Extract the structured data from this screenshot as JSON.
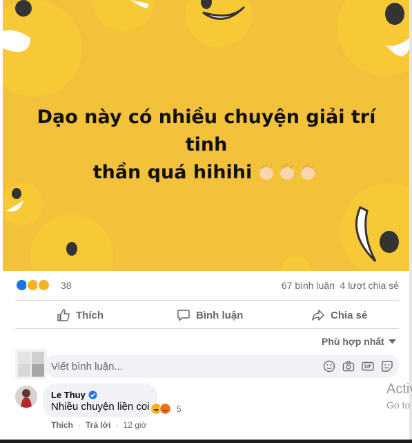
{
  "post": {
    "text_line1": "Dạo này có nhiều chuyện giải trí tinh",
    "text_line2": "thần quá hihihi",
    "background_color": "#f4c13a",
    "emoji_icons": [
      "clapping-hands-icon",
      "clapping-hands-icon",
      "clapping-hands-icon"
    ]
  },
  "stats": {
    "reaction_icons": [
      "like-reaction-icon",
      "haha-reaction-icon",
      "care-reaction-icon"
    ],
    "reaction_count": "38",
    "comments": "67 bình luận",
    "shares": "4 lượt chia sẻ"
  },
  "actions": {
    "like": "Thích",
    "comment": "Bình luận",
    "share": "Chia sẻ"
  },
  "sort_label": "Phù hợp nhất",
  "comment_box": {
    "placeholder": "Viết bình luận..."
  },
  "comment": {
    "author": "Le Thuy",
    "verified": true,
    "text": "Nhiều chuyện liền coi",
    "reactions": [
      "haha-reaction-icon",
      "angry-reaction-icon"
    ],
    "reaction_count": "5",
    "like_label": "Thích",
    "reply_label": "Trả lời",
    "time": "12 giờ"
  },
  "overlay": {
    "activate_line1": "Activ",
    "activate_line2": "Go to"
  },
  "colors": {
    "accent": "#1b74e4",
    "secondary_text": "#65676b",
    "input_bg": "#f0f2f5"
  }
}
